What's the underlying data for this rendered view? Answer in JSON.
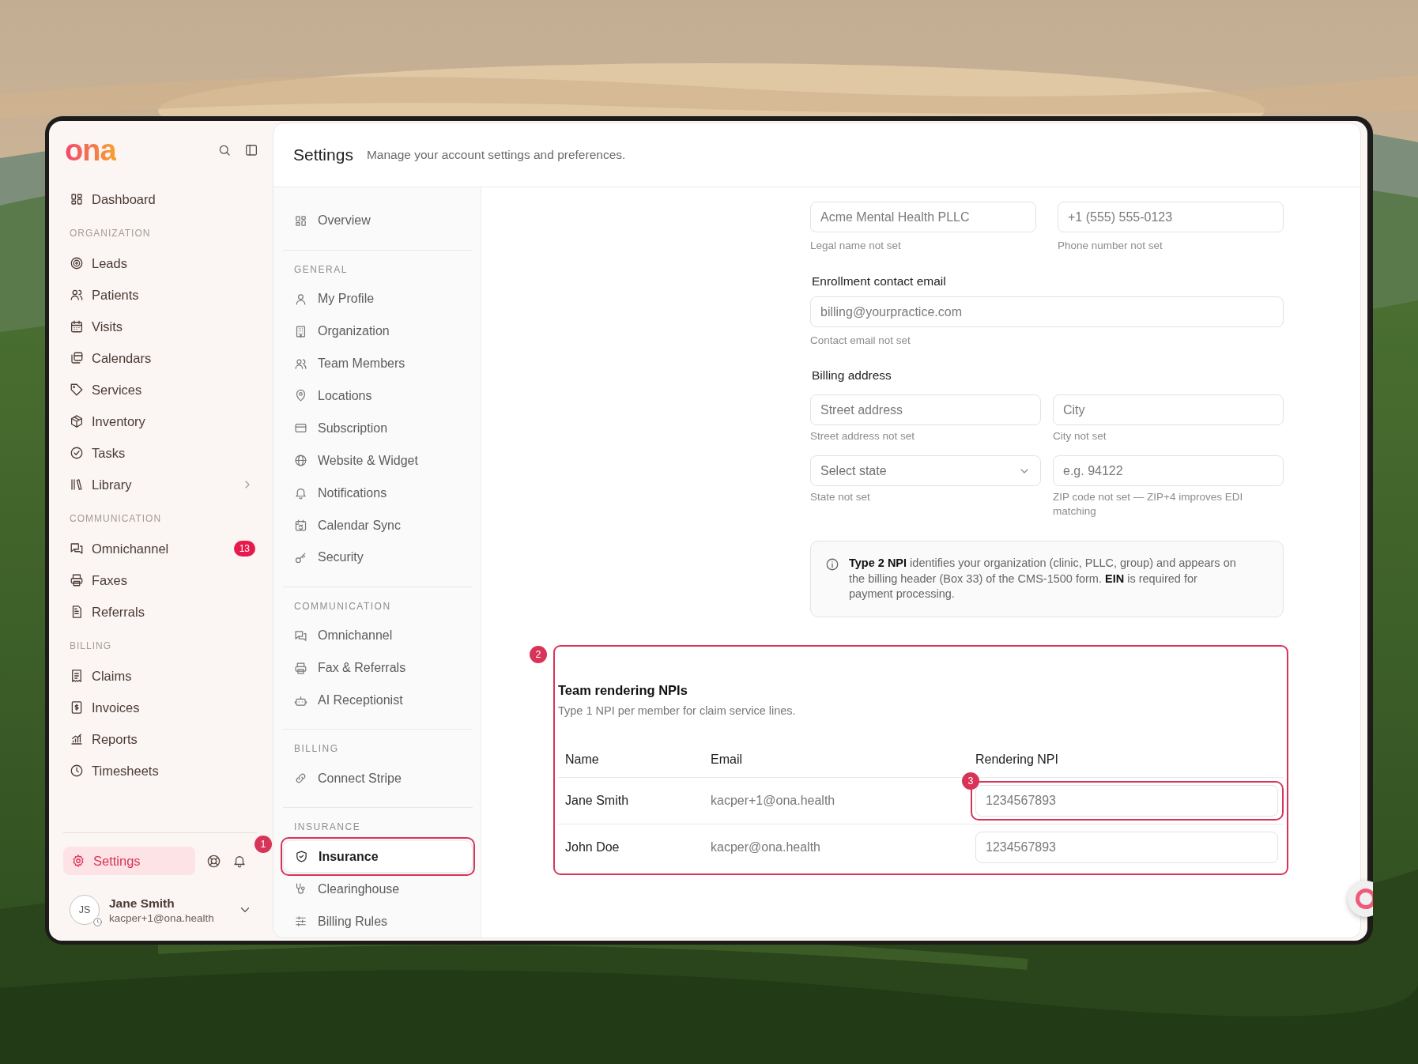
{
  "sidebar": {
    "logo": "ona",
    "items": [
      {
        "label": "Dashboard",
        "selected": false
      }
    ],
    "sections": [
      {
        "heading": "ORGANIZATION",
        "items": [
          {
            "label": "Leads",
            "selected": false
          },
          {
            "label": "Patients",
            "selected": false
          },
          {
            "label": "Visits",
            "selected": false
          },
          {
            "label": "Calendars",
            "selected": false
          },
          {
            "label": "Services",
            "selected": false
          },
          {
            "label": "Inventory",
            "selected": false
          },
          {
            "label": "Tasks",
            "selected": false
          },
          {
            "label": "Library",
            "selected": false,
            "has_submenu": true
          }
        ]
      },
      {
        "heading": "COMMUNICATION",
        "items": [
          {
            "label": "Omnichannel",
            "selected": false,
            "badge": "13"
          },
          {
            "label": "Faxes",
            "selected": false
          },
          {
            "label": "Referrals",
            "selected": false
          }
        ]
      },
      {
        "heading": "BILLING",
        "items": [
          {
            "label": "Claims",
            "selected": false
          },
          {
            "label": "Invoices",
            "selected": false
          },
          {
            "label": "Reports",
            "selected": false
          },
          {
            "label": "Timesheets",
            "selected": false
          }
        ]
      }
    ],
    "footer": {
      "settings": {
        "label": "Settings",
        "selected": true
      },
      "user": {
        "initials": "JS",
        "name": "Jane Smith",
        "email": "kacper+1@ona.health"
      }
    }
  },
  "header": {
    "title": "Settings",
    "subtitle": "Manage your account settings and preferences."
  },
  "settings_nav": {
    "items": [
      {
        "label": "Overview",
        "selected": false
      }
    ],
    "sections": [
      {
        "heading": "GENERAL",
        "items": [
          {
            "label": "My Profile",
            "selected": false
          },
          {
            "label": "Organization",
            "selected": false
          },
          {
            "label": "Team Members",
            "selected": false
          },
          {
            "label": "Locations",
            "selected": false
          },
          {
            "label": "Subscription",
            "selected": false
          },
          {
            "label": "Website & Widget",
            "selected": false
          },
          {
            "label": "Notifications",
            "selected": false
          },
          {
            "label": "Calendar Sync",
            "selected": false
          },
          {
            "label": "Security",
            "selected": false
          }
        ]
      },
      {
        "heading": "COMMUNICATION",
        "items": [
          {
            "label": "Omnichannel",
            "selected": false
          },
          {
            "label": "Fax & Referrals",
            "selected": false
          },
          {
            "label": "AI Receptionist",
            "selected": false
          }
        ]
      },
      {
        "heading": "BILLING",
        "items": [
          {
            "label": "Connect Stripe",
            "selected": false
          }
        ]
      },
      {
        "heading": "INSURANCE",
        "items": [
          {
            "label": "Insurance",
            "selected": true,
            "annotation": "1"
          },
          {
            "label": "Clearinghouse",
            "selected": false
          },
          {
            "label": "Billing Rules",
            "selected": false
          }
        ]
      }
    ]
  },
  "organization_form": {
    "top_fields": [
      {
        "placeholder": "Acme Mental Health PLLC",
        "hint": "Legal name not set"
      },
      {
        "placeholder": "+1 (555) 555-0123",
        "hint": "Phone number not set"
      }
    ],
    "contact_email": {
      "label": "Enrollment contact email",
      "placeholder": "billing@yourpractice.com",
      "hint": "Contact email not set"
    },
    "billing_address": {
      "label": "Billing address",
      "fields": [
        {
          "kind": "input",
          "placeholder": "Street address",
          "hint": "Street address not set"
        },
        {
          "kind": "input",
          "placeholder": "City",
          "hint": "City not set"
        },
        {
          "kind": "select",
          "placeholder": "Select state",
          "hint": "State not set"
        },
        {
          "kind": "input",
          "placeholder": "e.g. 94122",
          "hint": "ZIP code not set — ZIP+4 improves EDI matching"
        }
      ]
    },
    "info": "**Type 2 NPI** identifies your organization (clinic, PLLC, group) and appears on the billing header (Box 33) of the CMS-1500 form. **EIN** is required for payment processing."
  },
  "npi_section": {
    "annotation": "2",
    "title": "Team rendering NPIs",
    "subtitle": "Type 1 NPI per member for claim service lines.",
    "columns": [
      "Name",
      "Email",
      "Rendering NPI"
    ],
    "rows": [
      {
        "name": "Jane Smith",
        "email": "kacper+1@ona.health",
        "npi_placeholder": "1234567893",
        "annotation": "3"
      },
      {
        "name": "John Doe",
        "email": "kacper@ona.health",
        "npi_placeholder": "1234567893"
      }
    ]
  }
}
